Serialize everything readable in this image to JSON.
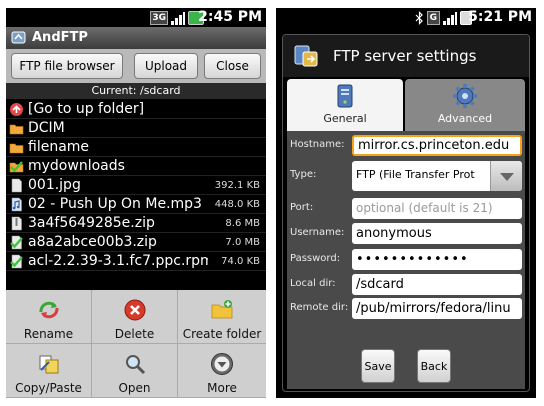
{
  "left": {
    "status": {
      "time": "2:45 PM",
      "network": "3G"
    },
    "app_title": "AndFTP",
    "buttons": {
      "browser": "FTP file browser",
      "upload": "Upload",
      "close": "Close"
    },
    "current_path": "Current: /sdcard",
    "files": [
      {
        "name": "[Go to up folder]",
        "size": "",
        "icon": "up-folder-icon"
      },
      {
        "name": "DCIM",
        "size": "",
        "icon": "folder-icon"
      },
      {
        "name": "filename",
        "size": "",
        "icon": "folder-icon"
      },
      {
        "name": "mydownloads",
        "size": "",
        "icon": "checked-folder-icon"
      },
      {
        "name": "001.jpg",
        "size": "392.1 KB",
        "icon": "file-icon"
      },
      {
        "name": "02 - Push Up On Me.mp3",
        "size": "448.0 KB",
        "icon": "music-file-icon"
      },
      {
        "name": "3a4f5649285e.zip",
        "size": "8.6 MB",
        "icon": "file-icon"
      },
      {
        "name": "a8a2abce00b3.zip",
        "size": "7.0 MB",
        "icon": "checked-file-icon"
      },
      {
        "name": "acl-2.2.39-3.1.fc7.ppc.rpm",
        "size": "74.0 KB",
        "icon": "checked-file-icon"
      }
    ],
    "menu": [
      {
        "label": "Rename",
        "icon": "rename-icon"
      },
      {
        "label": "Delete",
        "icon": "delete-icon"
      },
      {
        "label": "Create folder",
        "icon": "create-folder-icon"
      },
      {
        "label": "Copy/Paste",
        "icon": "copy-paste-icon"
      },
      {
        "label": "Open",
        "icon": "open-icon"
      },
      {
        "label": "More",
        "icon": "more-icon"
      }
    ]
  },
  "right": {
    "status": {
      "time": "5:21 PM",
      "network": "G"
    },
    "dialog_title": "FTP server settings",
    "tabs": {
      "general": "General",
      "advanced": "Advanced"
    },
    "fields": {
      "hostname_label": "Hostname:",
      "hostname_value": "mirror.cs.princeton.edu",
      "type_label": "Type:",
      "type_value": "FTP (File Transfer Prot",
      "port_label": "Port:",
      "port_placeholder": "optional (default is 21)",
      "username_label": "Username:",
      "username_value": "anonymous",
      "password_label": "Password:",
      "password_value": "•••••••••••••",
      "localdir_label": "Local dir:",
      "localdir_value": "/sdcard",
      "remotedir_label": "Remote dir:",
      "remotedir_value": "/pub/mirrors/fedora/linu"
    },
    "buttons": {
      "save": "Save",
      "back": "Back"
    }
  }
}
